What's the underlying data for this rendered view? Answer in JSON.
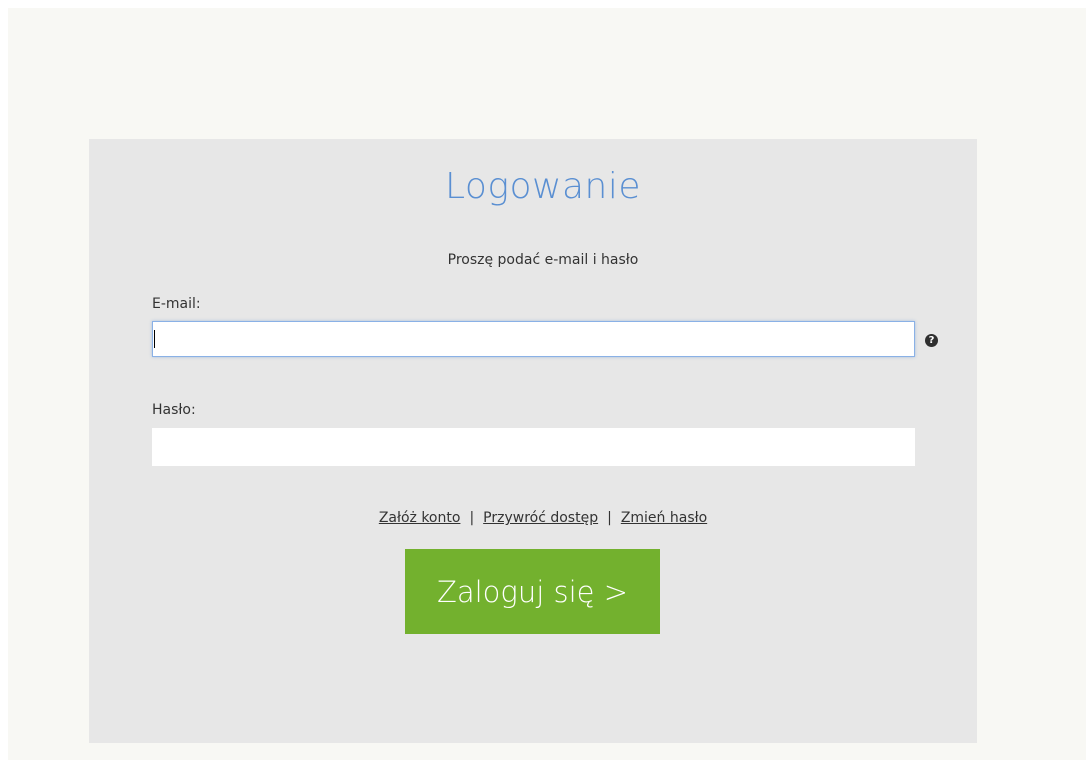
{
  "login": {
    "title": "Logowanie",
    "subtitle": "Proszę podać e-mail i hasło",
    "email_label": "E-mail:",
    "email_value": "",
    "password_label": "Hasło:",
    "password_value": "",
    "help_icon": "question-circle-icon",
    "links": {
      "register": "Załóż konto",
      "restore": "Przywróć dostęp",
      "change_password": "Zmień hasło",
      "separator": "|"
    },
    "submit_label": "Zaloguj się >"
  },
  "colors": {
    "page_background": "#f8f8f4",
    "panel_background": "#e7e7e7",
    "title_color": "#5a8fd2",
    "button_color": "#73b12e"
  }
}
